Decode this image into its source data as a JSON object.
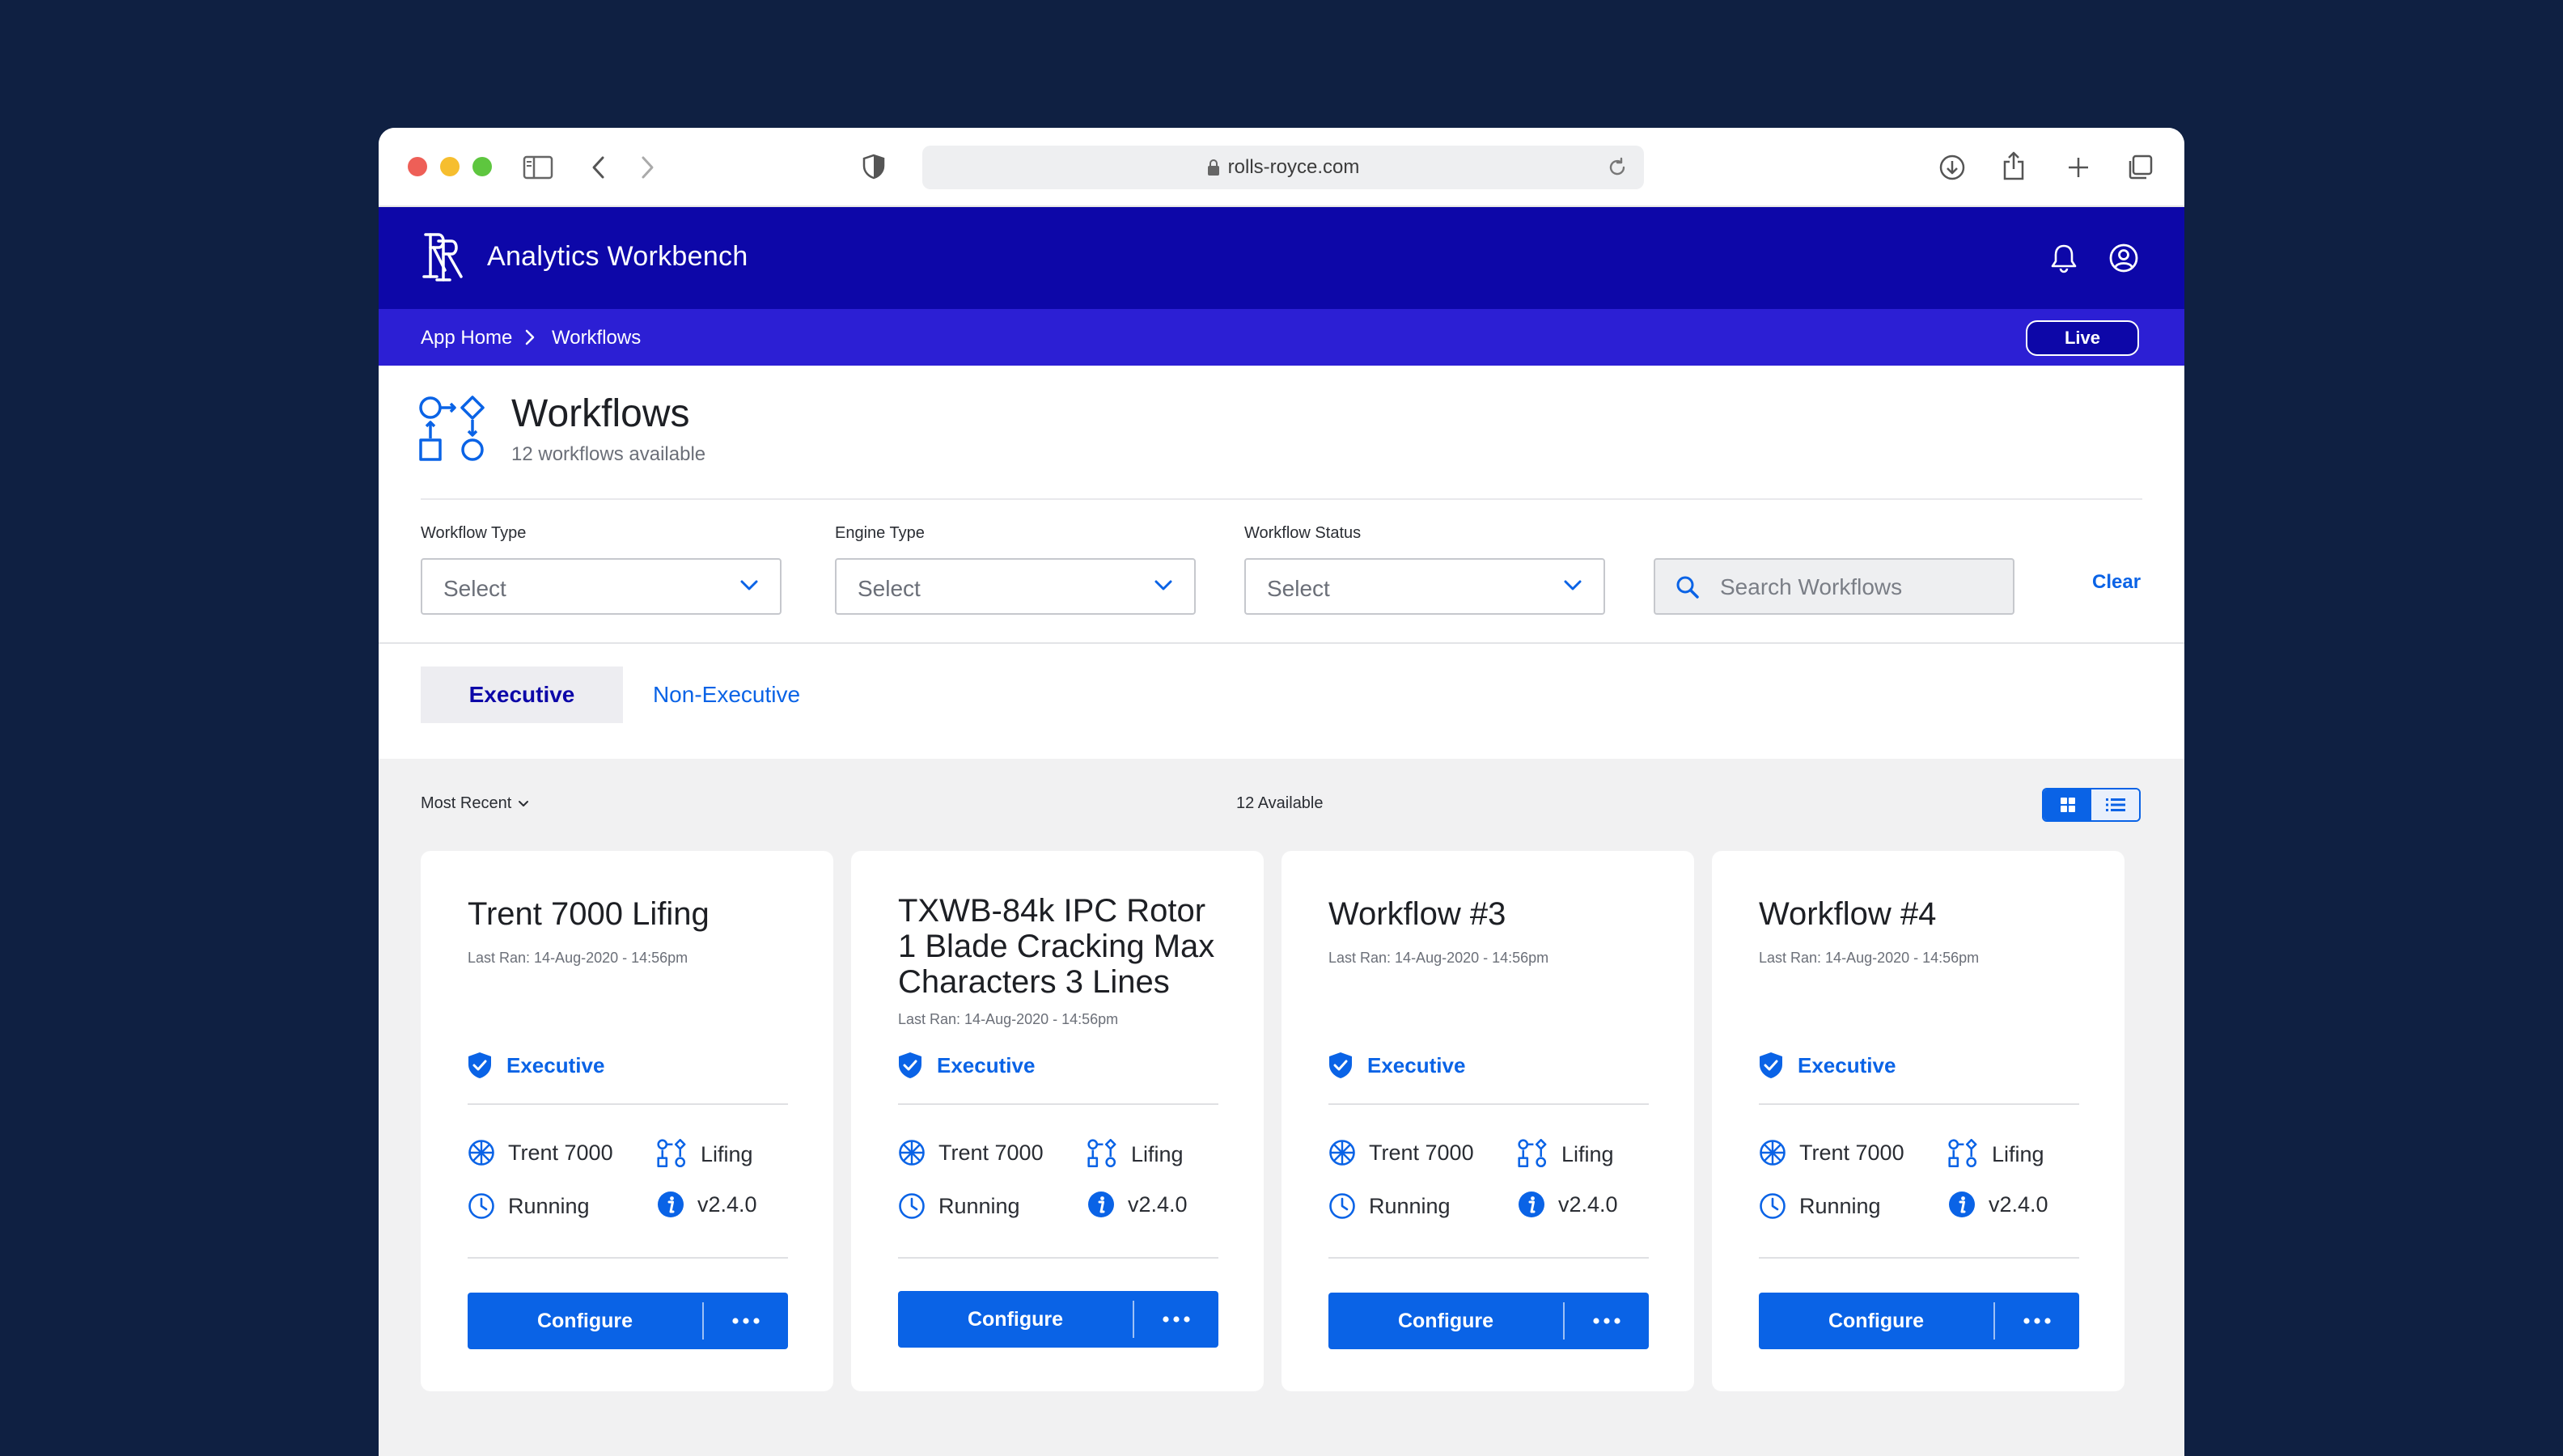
{
  "browser": {
    "url": "rolls-royce.com"
  },
  "app": {
    "title": "Analytics Workbench"
  },
  "breadcrumb": {
    "home": "App Home",
    "current": "Workflows",
    "live_label": "Live"
  },
  "page": {
    "title": "Workflows",
    "subtitle": "12 workflows available"
  },
  "filters": {
    "workflow_type": {
      "label": "Workflow Type",
      "value": "Select"
    },
    "engine_type": {
      "label": "Engine Type",
      "value": "Select"
    },
    "workflow_status": {
      "label": "Workflow Status",
      "value": "Select"
    },
    "search_placeholder": "Search Workflows",
    "clear_label": "Clear"
  },
  "tabs": [
    {
      "label": "Executive",
      "active": true
    },
    {
      "label": "Non-Executive",
      "active": false
    }
  ],
  "list": {
    "sort_label": "Most Recent",
    "available_label": "12 Available",
    "view": "grid"
  },
  "colors": {
    "header": "#0d07a8",
    "breadcrumb_bar": "#2c1fd4",
    "accent": "#0a63e6",
    "background": "#0f2042"
  },
  "cards": [
    {
      "title": "Trent 7000 Lifing",
      "last_ran": "Last Ran: 14-Aug-2020 - 14:56pm",
      "badge": "Executive",
      "engine": "Trent 7000",
      "type": "Lifing",
      "status": "Running",
      "version": "v2.4.0",
      "configure_label": "Configure"
    },
    {
      "title": "TXWB-84k IPC Rotor 1 Blade Cracking Max Characters 3 Lines",
      "last_ran": "Last Ran: 14-Aug-2020 - 14:56pm",
      "badge": "Executive",
      "engine": "Trent 7000",
      "type": "Lifing",
      "status": "Running",
      "version": "v2.4.0",
      "configure_label": "Configure"
    },
    {
      "title": "Workflow #3",
      "last_ran": "Last Ran: 14-Aug-2020 - 14:56pm",
      "badge": "Executive",
      "engine": "Trent 7000",
      "type": "Lifing",
      "status": "Running",
      "version": "v2.4.0",
      "configure_label": "Configure"
    },
    {
      "title": "Workflow #4",
      "last_ran": "Last Ran: 14-Aug-2020 - 14:56pm",
      "badge": "Executive",
      "engine": "Trent 7000",
      "type": "Lifing",
      "status": "Running",
      "version": "v2.4.0",
      "configure_label": "Configure"
    }
  ]
}
